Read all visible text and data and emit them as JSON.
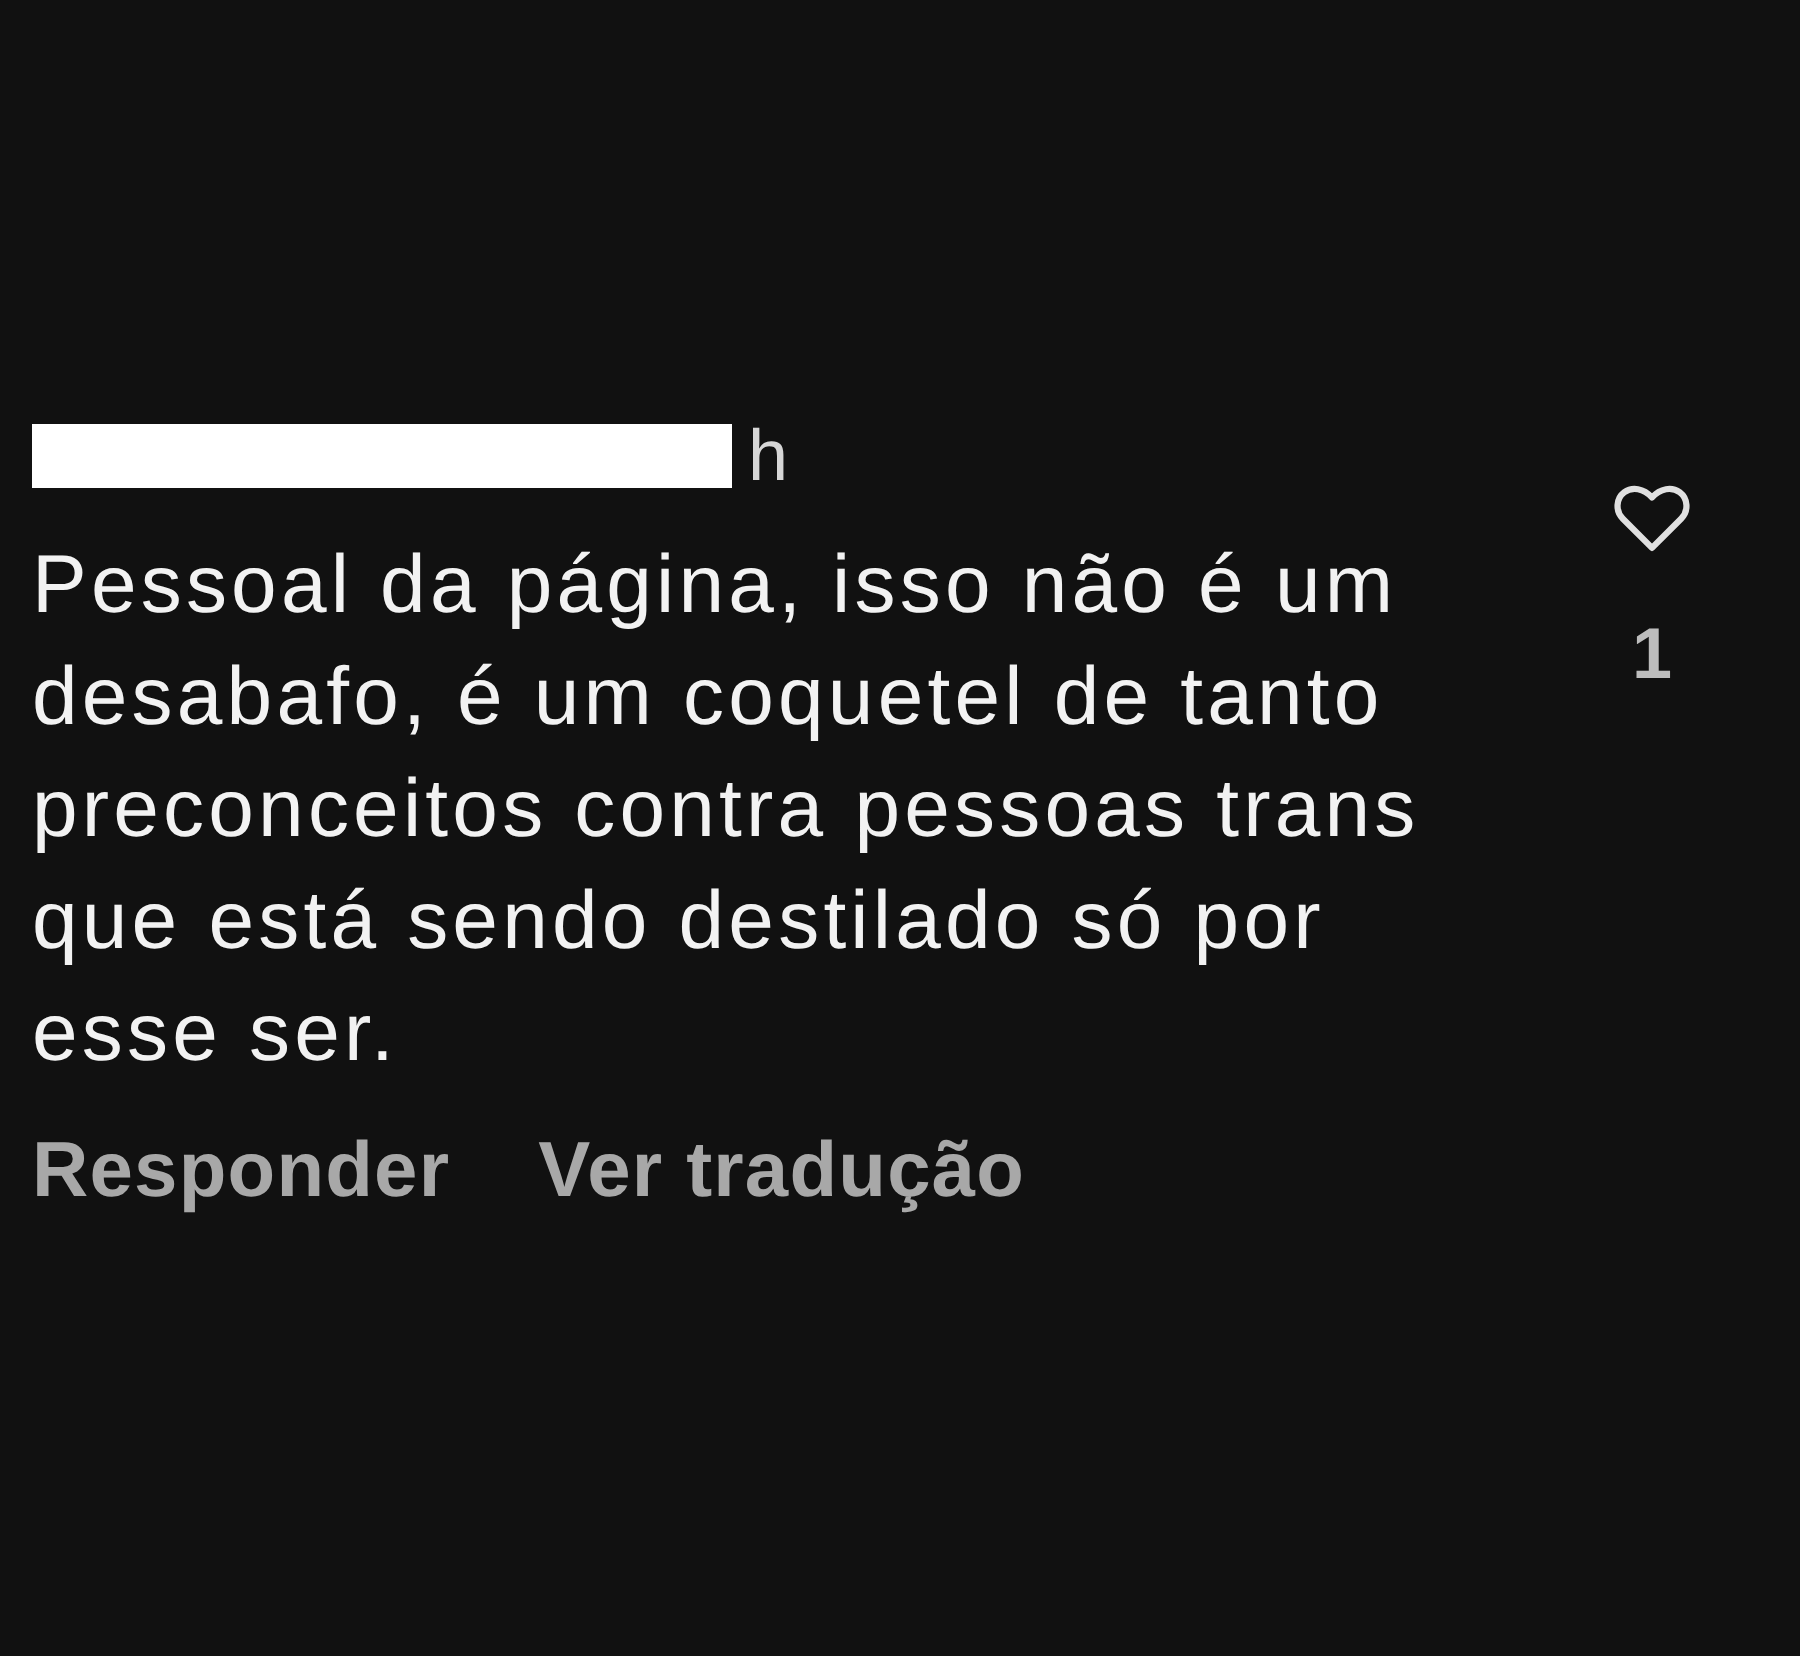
{
  "comment": {
    "author": {
      "redacted": true
    },
    "timestamp": "h",
    "text": "Pessoal da página, isso não é um desabafo, é um coquetel de tanto preconceitos contra pessoas trans que está sendo destilado só por esse ser.",
    "actions": [
      "Responder",
      "Ver tradução"
    ],
    "like": {
      "liked": false,
      "count": "1"
    }
  }
}
